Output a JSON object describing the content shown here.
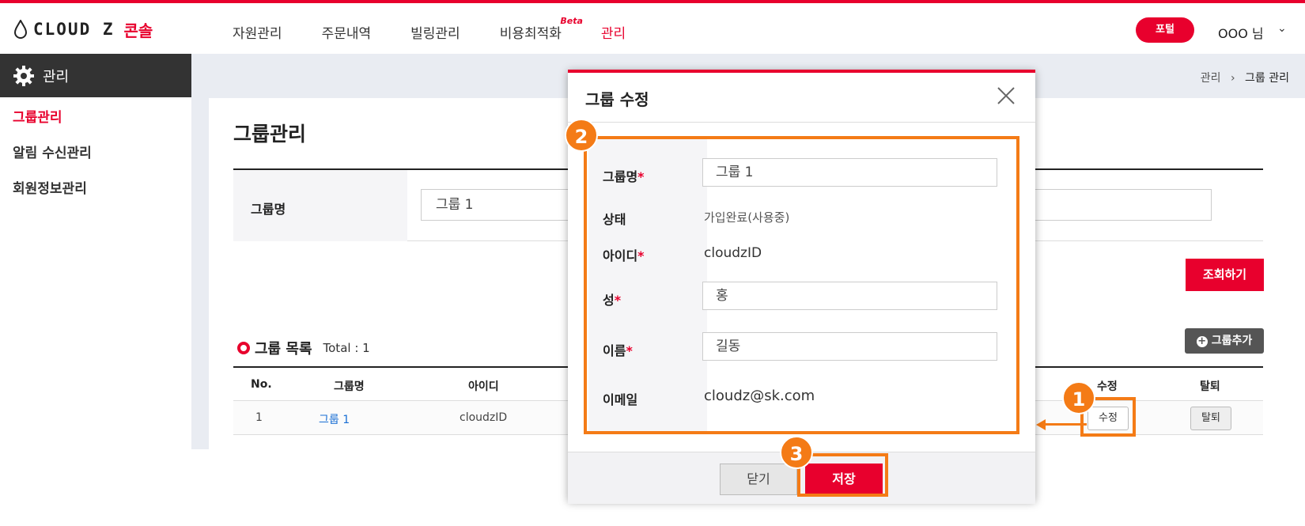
{
  "header": {
    "logo_text": "CLOUD Z",
    "logo_sub": "콘솔",
    "nav": [
      "자원관리",
      "주문내역",
      "빌링관리",
      "비용최적화",
      "관리"
    ],
    "beta_label": "Beta",
    "portal_label": "포털",
    "user_label": "OOO  님",
    "user_chevron": "⌄"
  },
  "sidebar": {
    "title": "관리",
    "items": [
      "그룹관리",
      "알림 수신관리",
      "회원정보관리"
    ]
  },
  "breadcrumb": {
    "root": "관리",
    "sep": "›",
    "current": "그룹 관리"
  },
  "page": {
    "title": "그룹관리",
    "search_label": "그룹명",
    "search_value": "그룹 1",
    "query_button": "조회하기",
    "list_title": "그룹 목록",
    "list_total": "Total : 1",
    "add_group_button": "그룹추가",
    "table": {
      "headers": [
        "No.",
        "그룹명",
        "아이디",
        "수정",
        "탈퇴"
      ],
      "rows": [
        {
          "no": "1",
          "group": "그룹 1",
          "id": "cloudzID",
          "edit": "수정",
          "leave": "탈퇴"
        }
      ]
    }
  },
  "modal": {
    "title": "그룹 수정",
    "fields": {
      "group_name_label": "그룹명",
      "group_name_value": "그룹 1",
      "status_label": "상태",
      "status_value": "가입완료(사용중)",
      "id_label": "아이디",
      "id_value": "cloudzID",
      "last_name_label": "성",
      "last_name_value": "홍",
      "first_name_label": "이름",
      "first_name_value": "길동",
      "email_label": "이메일",
      "email_value": "cloudz@sk.com"
    },
    "required_mark": "*",
    "close_button": "닫기",
    "save_button": "저장"
  },
  "annotations": {
    "badge1": "1",
    "badge2": "2",
    "badge3": "3",
    "highlight_color": "#f47b16"
  },
  "colors": {
    "accent": "#e8002d",
    "sidebar_dark": "#333333",
    "link": "#1a6fd4"
  }
}
